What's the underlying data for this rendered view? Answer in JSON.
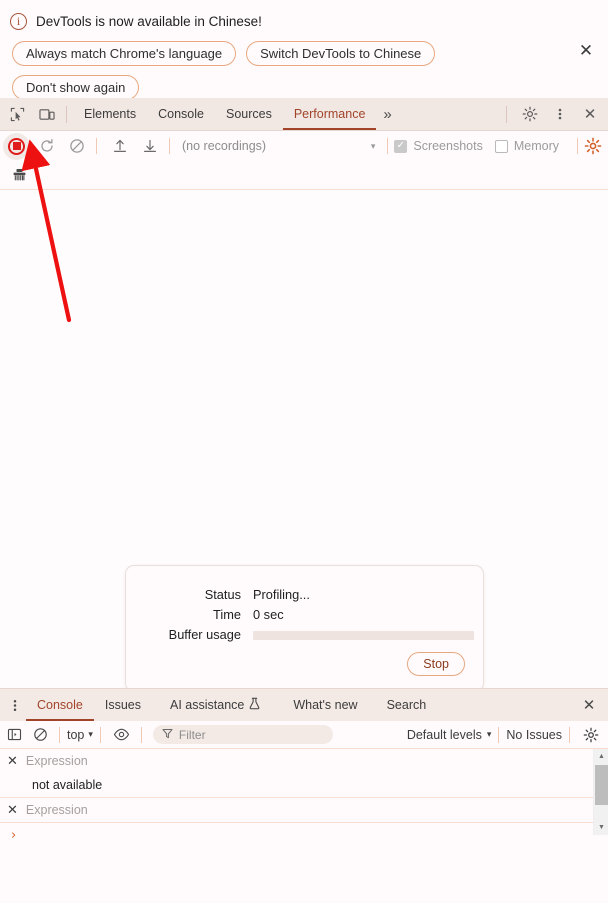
{
  "banner": {
    "icon": "info-icon",
    "title": "DevTools is now available in Chinese!",
    "buttons": [
      {
        "label": "Always match Chrome's language"
      },
      {
        "label": "Switch DevTools to Chinese"
      },
      {
        "label": "Don't show again"
      }
    ],
    "close_label": "✕"
  },
  "tabbar": {
    "inspect_icon": "inspect-element-icon",
    "device_icon": "device-toolbar-icon",
    "tabs": [
      {
        "label": "Elements",
        "active": false
      },
      {
        "label": "Console",
        "active": false
      },
      {
        "label": "Sources",
        "active": false
      },
      {
        "label": "Performance",
        "active": true
      }
    ],
    "more_label": "»",
    "settings_icon": "gear-icon",
    "kebab_icon": "more-options-icon",
    "close_label": "✕"
  },
  "perf_toolbar": {
    "record_icon": "record-stop-icon",
    "reload_icon": "reload-and-record-icon",
    "clear_icon": "clear-recording-icon",
    "upload_icon": "load-profile-icon",
    "download_icon": "save-profile-icon",
    "recordings_value": "(no recordings)",
    "caret": "▾",
    "screenshots_label": "Screenshots",
    "screenshots_checked": true,
    "memory_label": "Memory",
    "memory_checked": false,
    "capture_settings_icon": "capture-settings-gear-icon",
    "broom_icon": "clear-icon"
  },
  "status_dialog": {
    "rows": [
      {
        "label": "Status",
        "value": "Profiling..."
      },
      {
        "label": "Time",
        "value": "0 sec"
      }
    ],
    "buffer_label": "Buffer usage",
    "buffer_percent": 0,
    "stop_label": "Stop"
  },
  "drawer": {
    "kebab_icon": "drawer-more-options-icon",
    "tabs": [
      {
        "label": "Console",
        "active": true,
        "icon": ""
      },
      {
        "label": "Issues",
        "active": false,
        "icon": ""
      },
      {
        "label": "AI assistance",
        "active": false,
        "icon": "experiment-flask-icon"
      },
      {
        "label": "What's new",
        "active": false,
        "icon": ""
      },
      {
        "label": "Search",
        "active": false,
        "icon": ""
      }
    ],
    "close_label": "✕"
  },
  "console_toolbar": {
    "sidebar_icon": "console-sidebar-icon",
    "clear_icon": "clear-console-icon",
    "context_value": "top",
    "context_caret": "▾",
    "eye_icon": "create-live-expression-icon",
    "filter_icon": "filter-icon",
    "filter_placeholder": "Filter",
    "levels_value": "Default levels",
    "levels_caret": "▾",
    "issues_value": "No Issues",
    "settings_icon": "console-settings-gear-icon"
  },
  "console_body": {
    "live_expressions": [
      {
        "close": "✕",
        "placeholder": "Expression",
        "value": "not available"
      },
      {
        "close": "✕",
        "placeholder": "Expression",
        "value": ""
      }
    ],
    "prompt_caret": "›"
  },
  "scrollbar": {
    "up_arrow": "▲",
    "down_arrow": "▼"
  },
  "annotation": {
    "arrow_color": "#ee1111",
    "arrow_name": "red-pointer-arrow"
  }
}
